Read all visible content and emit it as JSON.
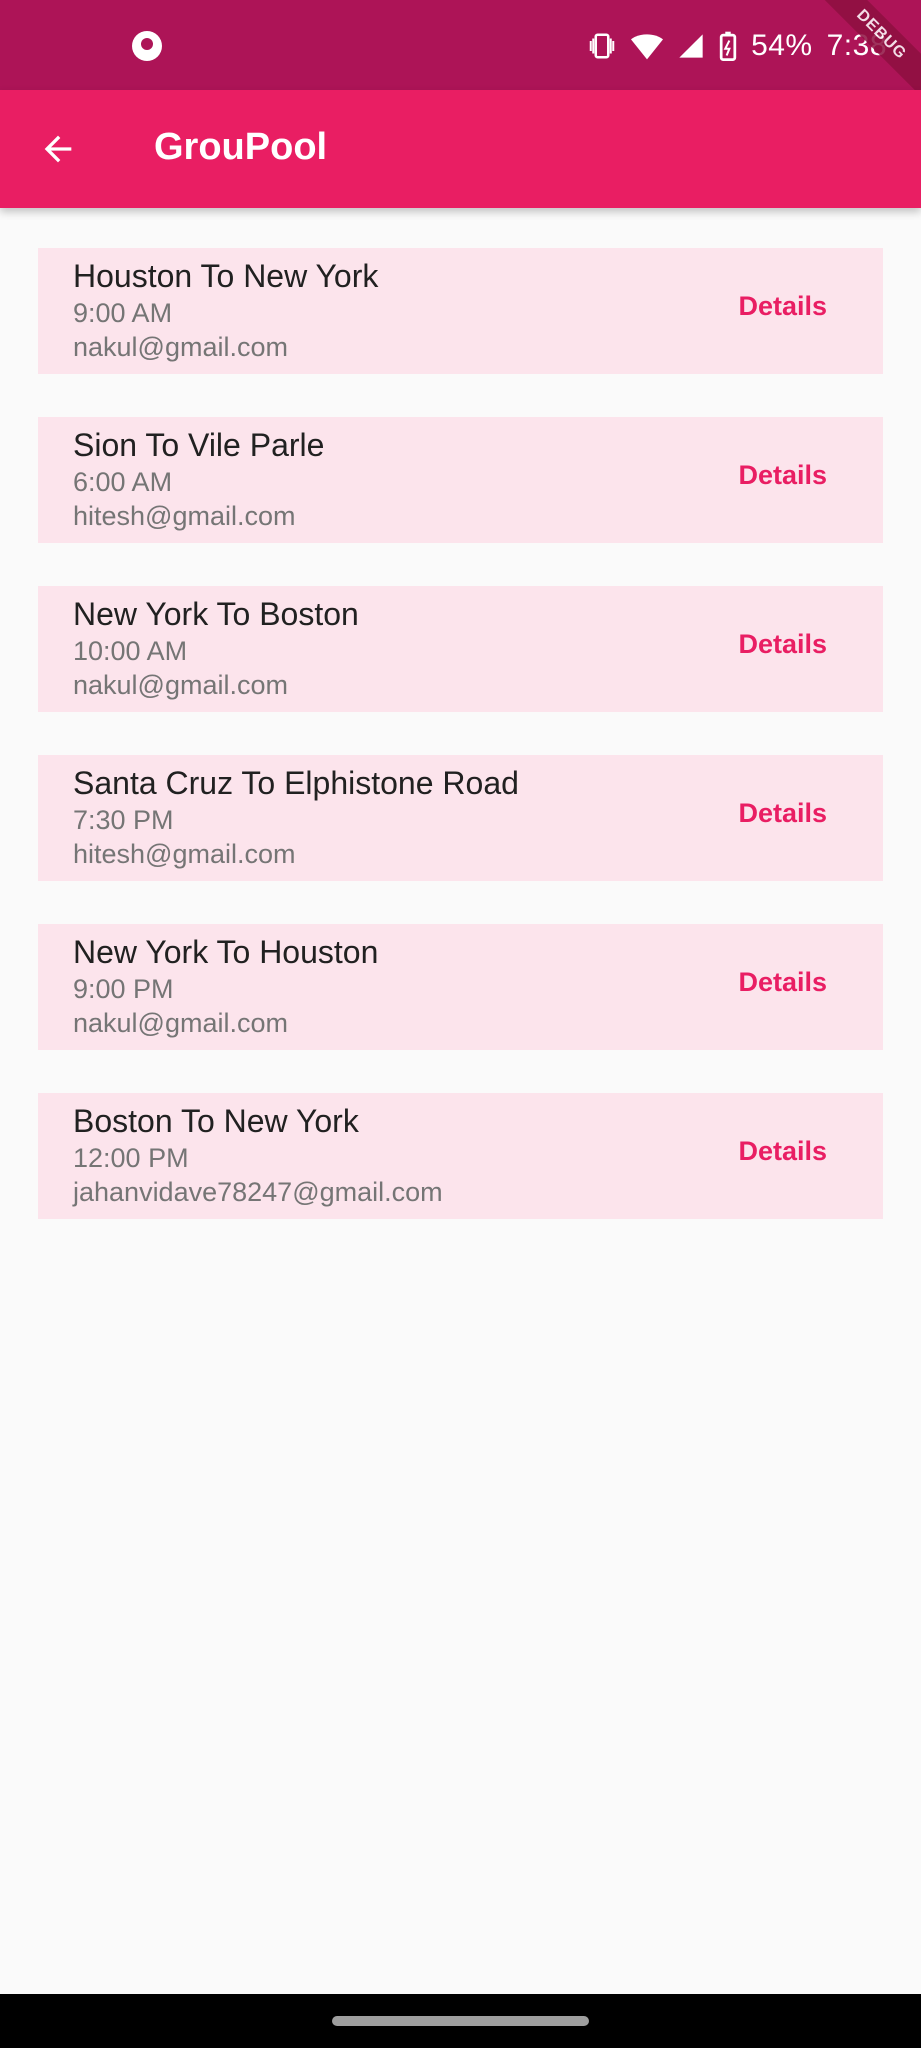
{
  "status_bar": {
    "battery": "54%",
    "time": "7:38",
    "debug_label": "DEBUG"
  },
  "app_bar": {
    "title": "GrouPool"
  },
  "rides": [
    {
      "title": "Houston To New York",
      "time": "9:00 AM",
      "email": "nakul@gmail.com",
      "action": "Details"
    },
    {
      "title": "Sion To Vile Parle",
      "time": "6:00 AM",
      "email": "hitesh@gmail.com",
      "action": "Details"
    },
    {
      "title": "New York To Boston",
      "time": "10:00 AM",
      "email": "nakul@gmail.com",
      "action": "Details"
    },
    {
      "title": "Santa Cruz To Elphistone Road",
      "time": "7:30 PM",
      "email": "hitesh@gmail.com",
      "action": "Details"
    },
    {
      "title": "New York To Houston",
      "time": "9:00 PM",
      "email": "nakul@gmail.com",
      "action": "Details"
    },
    {
      "title": "Boston To New York",
      "time": "12:00 PM",
      "email": "jahanvidave78247@gmail.com",
      "action": "Details"
    }
  ],
  "colors": {
    "primary": "#e91e63",
    "primary_dark": "#ad1457",
    "card_bg": "#fce4ec"
  }
}
